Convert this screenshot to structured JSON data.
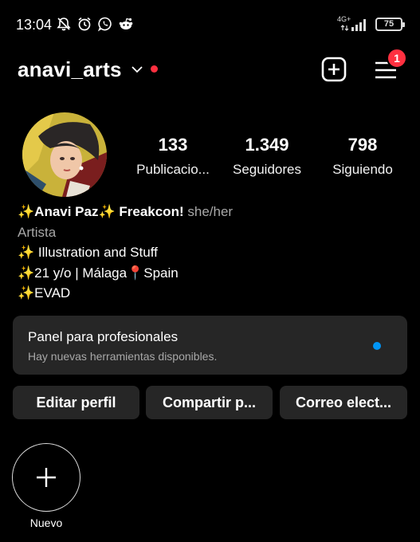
{
  "status_bar": {
    "time": "13:04",
    "network": "4G+",
    "battery": "75",
    "icons": [
      "mute-notification-icon",
      "alarm-icon",
      "whatsapp-icon",
      "reddit-icon",
      "signal-icon",
      "battery-icon"
    ]
  },
  "header": {
    "username": "anavi_arts",
    "menu_badge": "1",
    "icons": [
      "chevron-down-icon",
      "add-post-icon",
      "menu-icon"
    ]
  },
  "stats": {
    "posts_value": "133",
    "posts_label": "Publicacio...",
    "followers_value": "1.349",
    "followers_label": "Seguidores",
    "following_value": "798",
    "following_label": "Siguiendo"
  },
  "bio": {
    "name": "✨Anavi Paz✨ Freakcon!",
    "pronouns": "she/her",
    "category": "Artista",
    "lines": [
      "✨ Illustration and Stuff",
      "✨21 y/o | Málaga📍Spain",
      "✨EVAD"
    ]
  },
  "professional_panel": {
    "title": "Panel para profesionales",
    "subtitle": "Hay nuevas herramientas disponibles."
  },
  "buttons": {
    "edit": "Editar perfil",
    "share": "Compartir p...",
    "email": "Correo elect..."
  },
  "highlights": {
    "new_label": "Nuevo"
  },
  "colors": {
    "background": "#000000",
    "surface": "#262626",
    "badge": "#ff3040",
    "accent_blue": "#0095f6",
    "secondary_text": "#a8a8a8"
  }
}
